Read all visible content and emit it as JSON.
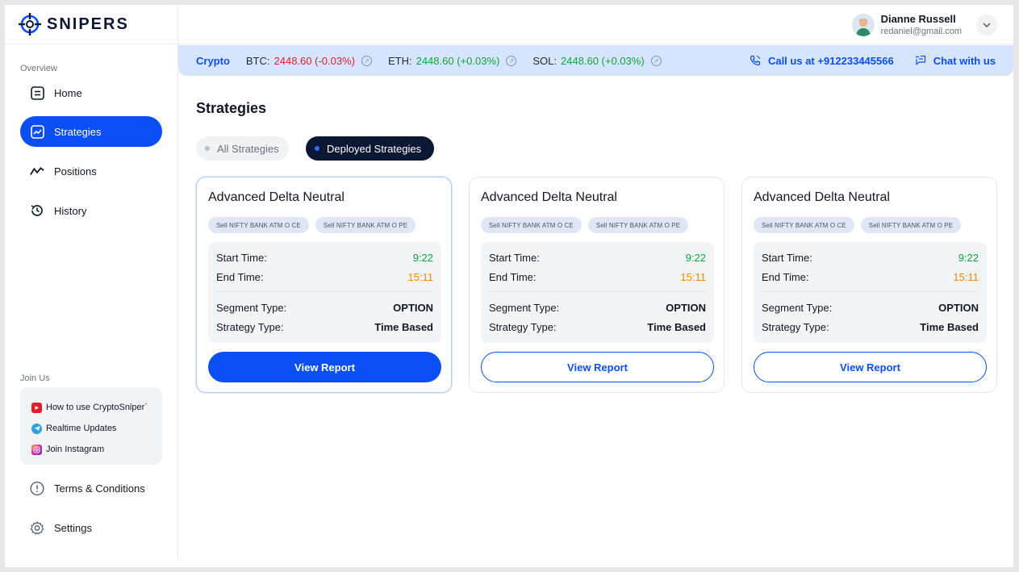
{
  "brand": {
    "name": "SNIPERS"
  },
  "sidebar": {
    "overview_label": "Overview",
    "items": [
      {
        "label": "Home",
        "icon": "home-icon"
      },
      {
        "label": "Strategies",
        "icon": "strategies-icon",
        "active": true
      },
      {
        "label": "Positions",
        "icon": "positions-icon"
      },
      {
        "label": "History",
        "icon": "history-icon"
      }
    ],
    "join_label": "Join Us",
    "join_links": [
      {
        "label": "How to use CryptoSniper`",
        "icon": "youtube-icon"
      },
      {
        "label": "Realtime Updates",
        "icon": "telegram-icon"
      },
      {
        "label": "Join Instagram",
        "icon": "instagram-icon"
      }
    ],
    "footer_items": [
      {
        "label": "Terms & Conditions",
        "icon": "info-icon"
      },
      {
        "label": "Settings",
        "icon": "gear-icon"
      }
    ]
  },
  "user": {
    "name": "Dianne Russell",
    "email": "redaniel@gmail.com"
  },
  "ticker": {
    "label": "Crypto",
    "items": [
      {
        "symbol": "BTC:",
        "value": "2448.60 (-0.03%)",
        "trend": "negative"
      },
      {
        "symbol": "ETH:",
        "value": "2448.60 (+0.03%)",
        "trend": "positive"
      },
      {
        "symbol": "SOL:",
        "value": "2448.60 (+0.03%)",
        "trend": "positive"
      }
    ],
    "call_label": "Call us at +912233445566",
    "chat_label": "Chat with us"
  },
  "main": {
    "title": "Strategies",
    "filters": {
      "all": "All Strategies",
      "deployed": "Deployed Strategies"
    },
    "cards": [
      {
        "title": "Advanced Delta Neutral",
        "tags": [
          "Sell NIFTY BANK ATM O CE",
          "Sell NIFTY BANK ATM O PE"
        ],
        "start_label": "Start Time:",
        "start_value": "9:22",
        "end_label": "End Time:",
        "end_value": "15:11",
        "segment_label": "Segment Type:",
        "segment_value": "OPTION",
        "strategy_label": "Strategy Type:",
        "strategy_value": "Time Based",
        "button": "View Report"
      },
      {
        "title": "Advanced Delta Neutral",
        "tags": [
          "Sell NIFTY BANK ATM O CE",
          "Sell NIFTY BANK ATM O PE"
        ],
        "start_label": "Start Time:",
        "start_value": "9:22",
        "end_label": "End Time:",
        "end_value": "15:11",
        "segment_label": "Segment Type:",
        "segment_value": "OPTION",
        "strategy_label": "Strategy Type:",
        "strategy_value": "Time Based",
        "button": "View Report"
      },
      {
        "title": "Advanced Delta Neutral",
        "tags": [
          "Sell NIFTY BANK ATM O CE",
          "Sell NIFTY BANK ATM O PE"
        ],
        "start_label": "Start Time:",
        "start_value": "9:22",
        "end_label": "End Time:",
        "end_value": "15:11",
        "segment_label": "Segment Type:",
        "segment_value": "OPTION",
        "strategy_label": "Strategy Type:",
        "strategy_value": "Time Based",
        "button": "View Report"
      }
    ]
  },
  "colors": {
    "accent": "#0a4ff5",
    "positive": "#12a53a",
    "negative": "#e11d2a",
    "warning": "#f08a00",
    "dark": "#0b1733"
  }
}
